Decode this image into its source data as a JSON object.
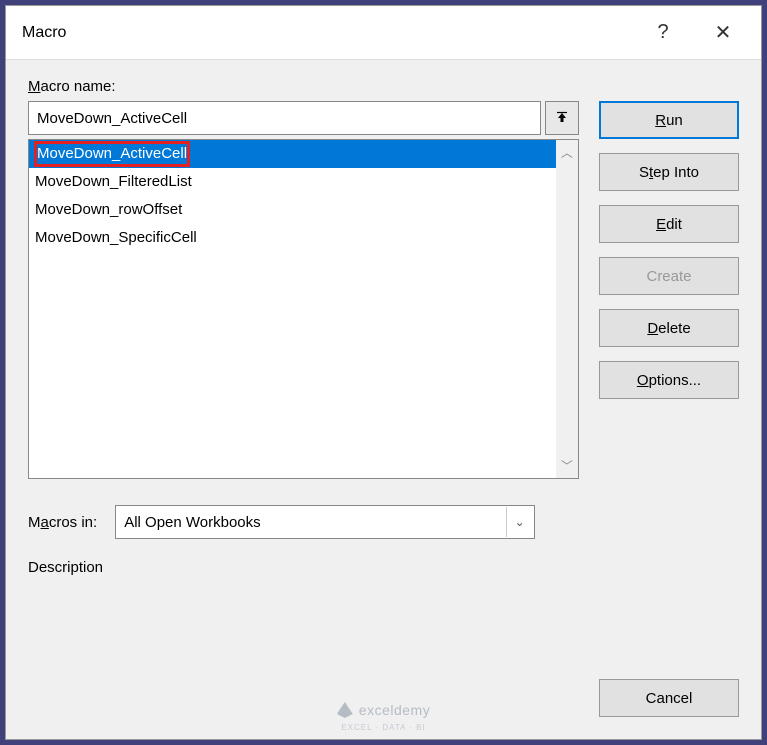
{
  "titlebar": {
    "title": "Macro",
    "help": "?",
    "close": "✕"
  },
  "labels": {
    "macro_name_pre": "M",
    "macro_name_post": "acro name:",
    "macros_in_pre": "M",
    "macros_in_post": "acros in:",
    "description": "Description"
  },
  "macro_name_value": "MoveDown_ActiveCell",
  "macro_list": [
    {
      "label": "MoveDown_ActiveCell",
      "selected": true,
      "highlighted": true
    },
    {
      "label": "MoveDown_FilteredList",
      "selected": false,
      "highlighted": false
    },
    {
      "label": "MoveDown_rowOffset",
      "selected": false,
      "highlighted": false
    },
    {
      "label": "MoveDown_SpecificCell",
      "selected": false,
      "highlighted": false
    }
  ],
  "macros_in_value": "All Open Workbooks",
  "buttons": {
    "run_u": "R",
    "run_rest": "un",
    "stepinto_pre": "S",
    "stepinto_u": "t",
    "stepinto_post": "ep Into",
    "edit_u": "E",
    "edit_rest": "dit",
    "create": "Create",
    "delete_u": "D",
    "delete_rest": "elete",
    "options_u": "O",
    "options_rest": "ptions...",
    "cancel": "Cancel"
  },
  "watermark": {
    "main": "exceldemy",
    "sub": "EXCEL · DATA · BI"
  }
}
